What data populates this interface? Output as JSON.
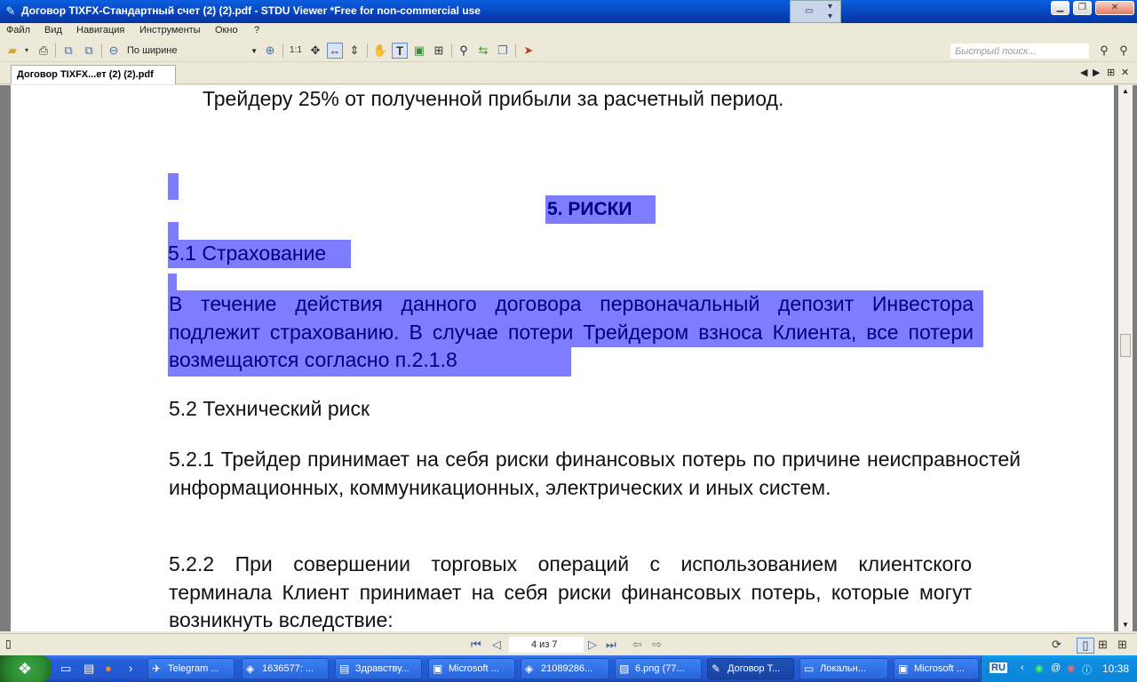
{
  "window": {
    "title": "Договор TIXFX-Стандартный счет (2) (2).pdf - STDU Viewer *Free for non-commercial use"
  },
  "menu": [
    "Файл",
    "Вид",
    "Навигация",
    "Инструменты",
    "Окно",
    "?"
  ],
  "toolbar": {
    "zoom_mode": "По ширине",
    "scale_label": "1:1",
    "search_placeholder": "Быстрый поиск..."
  },
  "tab": {
    "label": "Договор TIXFX...ет (2) (2).pdf"
  },
  "document": {
    "top_line": "Трейдеру 25% от полученной прибыли за расчетный период.",
    "section_heading": "5.  РИСКИ",
    "sub_1": "5.1 Страхование",
    "para_1": "В течение действия данного договора первоначальный депозит Инвестора подлежит страхованию. В случае потери Трейдером взноса Клиента, все потери возмещаются согласно п.2.1.8",
    "sub_2": "5.2 Технический риск",
    "para_2": "5.2.1 Трейдер принимает на себя риски финансовых потерь по причине неисправностей информационных, коммуникационных, электрических и иных систем.",
    "para_3": "5.2.2 При совершении торговых операций с использованием клиентского терминала Клиент принимает на себя риски финансовых потерь, которые могут возникнуть вследствие:"
  },
  "statusbar": {
    "page_indicator": "4 из 7"
  },
  "taskbar": {
    "tasks": [
      "Telegram ...",
      "1636577: ...",
      "Здравству...",
      "Microsoft ...",
      "21089286...",
      "6.png (77...",
      "Договор Т...",
      "Локальн...",
      "Microsoft ..."
    ],
    "language": "RU",
    "clock": "10:38"
  }
}
